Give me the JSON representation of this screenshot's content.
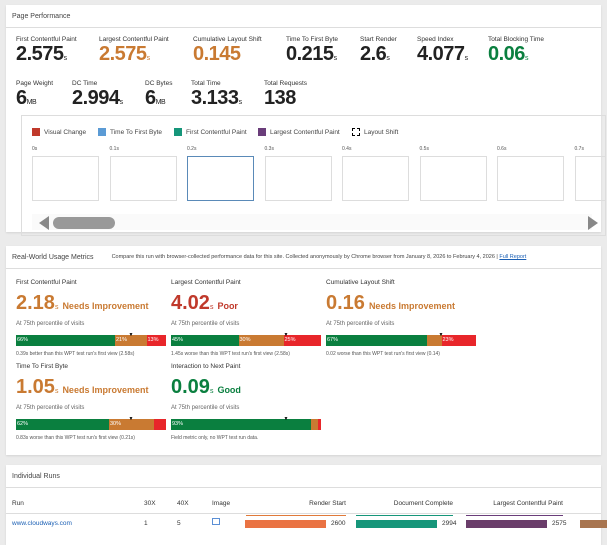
{
  "perf": {
    "title": "Page Performance",
    "metrics": [
      {
        "label": "First Contentful Paint",
        "value": "2.575",
        "unit": "s",
        "color": "#222"
      },
      {
        "label": "Largest Contentful Paint",
        "value": "2.575",
        "unit": "s",
        "color": "#c97a32"
      },
      {
        "label": "Cumulative Layout Shift",
        "value": "0.145",
        "unit": "",
        "color": "#c97a32"
      },
      {
        "label": "Time To First Byte",
        "value": "0.215",
        "unit": "s",
        "color": "#222"
      },
      {
        "label": "Start Render",
        "value": "2.6",
        "unit": "s",
        "color": "#222"
      },
      {
        "label": "Speed Index",
        "value": "4.077",
        "unit": "s",
        "color": "#222"
      },
      {
        "label": "Total Blocking Time",
        "value": "0.06",
        "unit": "s",
        "color": "#0a7f3f"
      },
      {
        "label": "Page Weight",
        "value": "6",
        "unit": "MB",
        "color": "#222"
      },
      {
        "label": "DC Time",
        "value": "2.994",
        "unit": "s",
        "color": "#222"
      },
      {
        "label": "DC Bytes",
        "value": "6",
        "unit": "MB",
        "color": "#222"
      },
      {
        "label": "Total Time",
        "value": "3.133",
        "unit": "s",
        "color": "#222"
      },
      {
        "label": "Total Requests",
        "value": "138",
        "unit": "",
        "color": "#222"
      }
    ],
    "legend": [
      {
        "label": "Visual Change",
        "color": "#c0392b"
      },
      {
        "label": "Time To First Byte",
        "color": "#5b9bd5"
      },
      {
        "label": "First Contentful Paint",
        "color": "#16967a"
      },
      {
        "label": "Largest Contentful Paint",
        "color": "#6a3d7a"
      },
      {
        "label": "Layout Shift",
        "color": "dashed"
      }
    ],
    "frames": [
      "0s",
      "0.1s",
      "0.2s",
      "0.3s",
      "0.4s",
      "0.5s",
      "0.6s",
      "0.7s"
    ],
    "selected_frame": 2,
    "scroll_position": 0.1
  },
  "rwum": {
    "title": "Real-World Usage Metrics",
    "desc": "Compare this run with browser-collected performance data for this site. Collected anonymously by Chrome browser from January 8, 2026 to February 4, 2026 |",
    "link": "Full Report",
    "metrics": [
      {
        "title": "First Contentful Paint",
        "value": "2.18",
        "unit": "s",
        "rating": "Needs Improvement",
        "color": "#c97a32",
        "pct": "At 75th percentile of visits",
        "dist": [
          66,
          21,
          13
        ],
        "labels": [
          "66%",
          "21%",
          "13%"
        ],
        "marker": 0.75,
        "note": "0.39s better than this WPT test run's first view (2.58s)"
      },
      {
        "title": "Largest Contentful Paint",
        "value": "4.02",
        "unit": "s",
        "rating": "Poor",
        "color": "#c0392b",
        "pct": "At 75th percentile of visits",
        "dist": [
          45,
          30,
          25
        ],
        "labels": [
          "45%",
          "30%",
          "25%"
        ],
        "marker": 0.75,
        "note": "1.45s worse than this WPT test run's first view (2.58s)"
      },
      {
        "title": "Cumulative Layout Shift",
        "value": "0.16",
        "unit": "",
        "rating": "Needs Improvement",
        "color": "#c97a32",
        "pct": "At 75th percentile of visits",
        "dist": [
          67,
          10,
          23
        ],
        "labels": [
          "67%",
          "",
          "23%"
        ],
        "marker": 0.75,
        "note": "0.02 worse than this WPT test run's first view (0.14)"
      },
      {
        "title": "Time To First Byte",
        "value": "1.05",
        "unit": "s",
        "rating": "Needs Improvement",
        "color": "#c97a32",
        "pct": "At 75th percentile of visits",
        "dist": [
          62,
          30,
          8
        ],
        "labels": [
          "62%",
          "30%",
          ""
        ],
        "marker": 0.75,
        "note": "0.83s worse than this WPT test run's first view (0.21s)"
      },
      {
        "title": "Interaction to Next Paint",
        "value": "0.09",
        "unit": "s",
        "rating": "Good",
        "color": "#0a7f3f",
        "pct": "At 75th percentile of visits",
        "dist": [
          93,
          5,
          2
        ],
        "labels": [
          "93%",
          "",
          ""
        ],
        "marker": 0.75,
        "note": "Field metric only, no WPT test run data."
      }
    ]
  },
  "runs": {
    "title": "Individual Runs",
    "headers": {
      "run": "Run",
      "c30": "30X",
      "c40": "40X",
      "image": "Image",
      "render": "Render Start",
      "dc": "Document Complete",
      "lcp": "Largest Contentful Paint"
    },
    "row": {
      "run": "www.cloudways.com",
      "c30": "1",
      "c40": "5",
      "render": "2600",
      "dc": "2994",
      "lcp": "2575"
    }
  }
}
